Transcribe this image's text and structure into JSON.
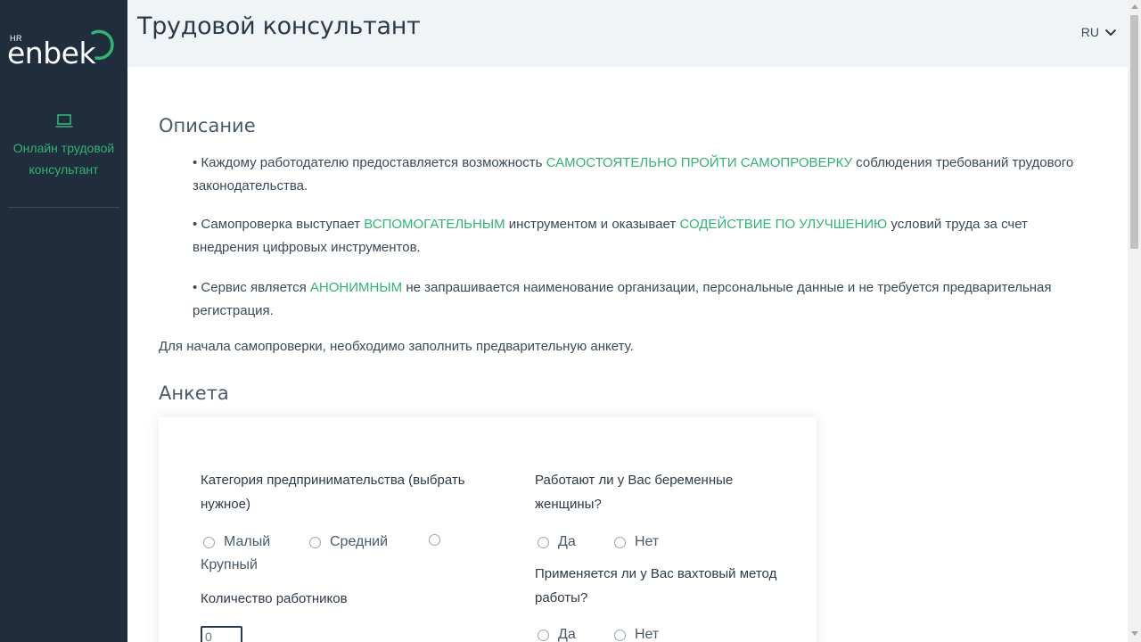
{
  "brand": {
    "hr": "HR",
    "name": "enbek"
  },
  "sidebar": {
    "item_label": "Онлайн трудовой консультант"
  },
  "header": {
    "title": "Трудовой консультант",
    "language": "RU"
  },
  "description": {
    "heading": "Описание",
    "p1_a": "• Каждому работодателю предоставляется возможность ",
    "p1_hl": "САМОСТОЯТЕЛЬНО ПРОЙТИ САМОПРОВЕРКУ",
    "p1_b": " соблюдения требований трудового законодательства.",
    "p2_a": "• Самопроверка выступает ",
    "p2_hl1": "ВСПОМОГАТЕЛЬНЫМ",
    "p2_b": " инструментом и оказывает ",
    "p2_hl2": "СОДЕЙСТВИЕ ПО УЛУЧШЕНИЮ",
    "p2_c": " условий труда за счет внедрения цифровых инструментов.",
    "p3_a": "• Сервис является ",
    "p3_hl": "АНОНИМНЫМ",
    "p3_b": " не запрашивается наименование организации, персональные данные и не требуется предварительная регистрация.",
    "intro": "Для начала самопроверки, необходимо заполнить предварительную анкету."
  },
  "form": {
    "heading": "Анкета",
    "category_label": "Категория предпринимательства (выбрать нужное)",
    "category_options": [
      "Малый",
      "Средний",
      "Крупный"
    ],
    "pregnant_label": "Работают ли у Вас беременные женщины?",
    "rotation_label": "Применяется ли у Вас вахтовый метод работы?",
    "yes": "Да",
    "no": "Нет",
    "employees_label": "Количество работников",
    "employees_value": "0"
  },
  "colors": {
    "accent": "#2fb573",
    "sidebar": "#1f2d3d",
    "header": "#f1f4f7"
  }
}
